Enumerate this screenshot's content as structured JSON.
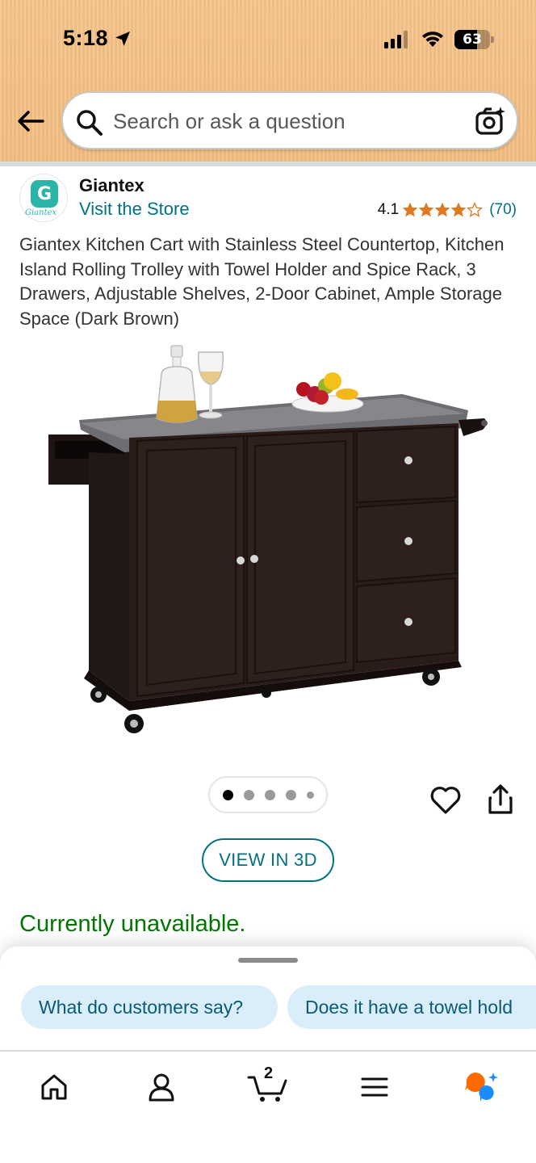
{
  "status_bar": {
    "time": "5:18",
    "battery": "63",
    "battery_level": 0.63
  },
  "header": {
    "search_placeholder": "Search or ask a question"
  },
  "store": {
    "brand": "Giantex",
    "logo_letter": "G",
    "logo_word": "Giantex",
    "visit_link": "Visit the Store",
    "rating_value": "4.1",
    "rating_stars": 4.1,
    "rating_count": "(70)"
  },
  "product": {
    "title": "Giantex Kitchen Cart with Stainless Steel Countertop, Kitchen Island Rolling Trolley with Towel Holder and Spice Rack, 3 Drawers, Adjustable Shelves, 2-Door Cabinet, Ample Storage Space (Dark Brown)",
    "image_alt": "Dark brown kitchen cart with stainless steel countertop",
    "image_count": 5,
    "current_image": 1,
    "view_3d_label": "VIEW IN 3D",
    "availability": "Currently unavailable.",
    "availability_color": "#007600"
  },
  "sheet": {
    "chips": [
      "What do customers say?",
      "Does it have a towel hold"
    ]
  },
  "tabbar": {
    "cart_count": "2",
    "items": [
      "home-icon",
      "account-icon",
      "cart-icon",
      "menu-icon",
      "rufus-icon"
    ]
  },
  "colors": {
    "link": "#007185",
    "star": "#de7921",
    "header_bg": "#f3bd80",
    "chip_bg": "#d9eef8"
  }
}
